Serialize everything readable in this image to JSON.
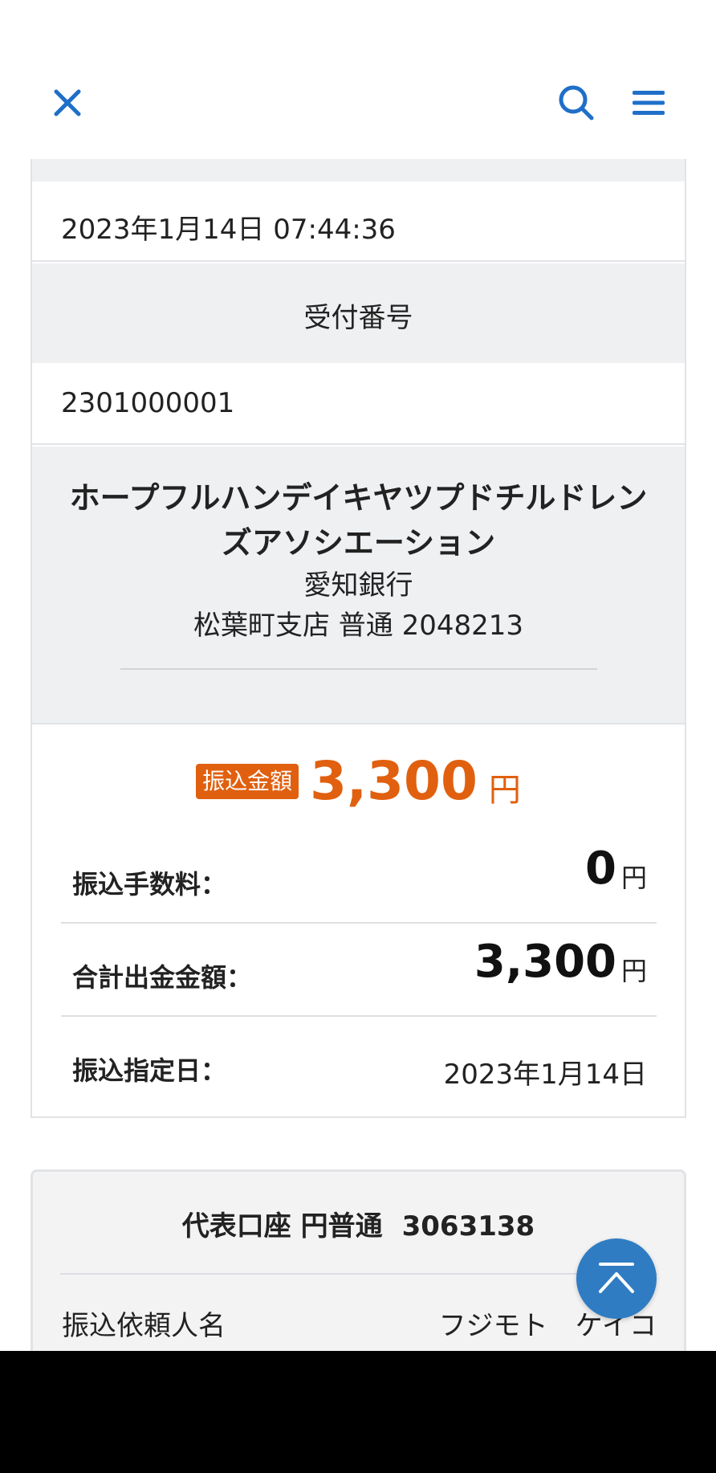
{
  "header": {
    "close_icon": "close-icon",
    "search_icon": "search-icon",
    "menu_icon": "hamburger-menu-icon",
    "icon_color": "#1f6fc9"
  },
  "transaction": {
    "datetime": "2023年1月14日 07:44:36",
    "receipt_label": "受付番号",
    "receipt_number": "2301000001"
  },
  "payee": {
    "name": "ホープフルハンデイキヤツプドチルドレンズアソシエーション",
    "bank": "愛知銀行",
    "branch_account": "松葉町支店 普通 2048213"
  },
  "amount": {
    "badge": "振込金額",
    "value": "3,300",
    "unit": "円",
    "accent_color": "#e0600f"
  },
  "details": [
    {
      "label": "振込手数料：",
      "value": "0",
      "unit": "円"
    },
    {
      "label": "合計出金金額：",
      "value": "3,300",
      "unit": "円"
    },
    {
      "label": "振込指定日：",
      "date": "2023年1月14日"
    }
  ],
  "account": {
    "title": "代表口座 円普通",
    "number": "3063138",
    "requester_label": "振込依頼人名",
    "requester_name": "フジモト　ケイコ"
  },
  "scroll_top": {
    "icon": "chevron-up-icon",
    "color": "#2f7cc2"
  }
}
